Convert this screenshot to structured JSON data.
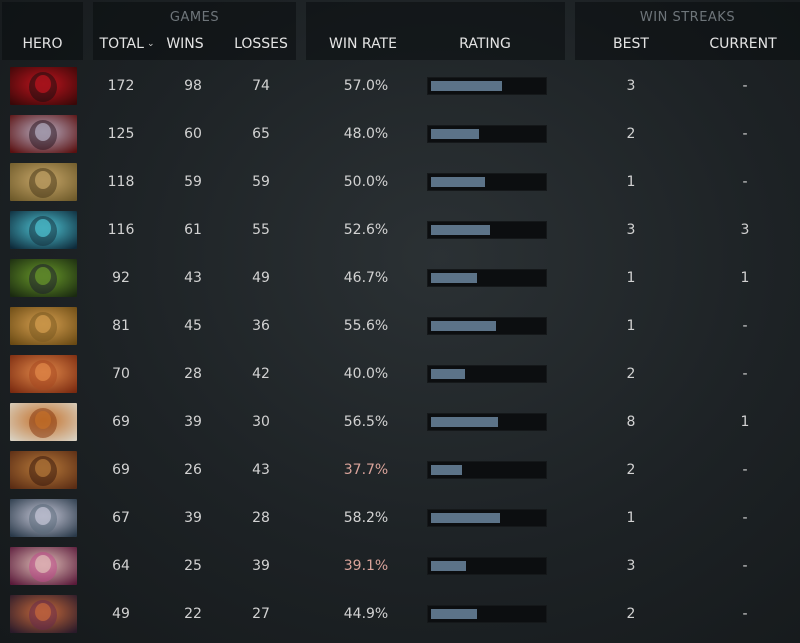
{
  "header": {
    "hero": "HERO",
    "games": "GAMES",
    "total": "TOTAL",
    "wins": "WINS",
    "losses": "LOSSES",
    "win_rate": "WIN RATE",
    "rating": "RATING",
    "win_streaks": "WIN STREAKS",
    "best": "BEST",
    "current": "CURRENT",
    "sort_icon": "chevron-down-icon"
  },
  "colors": {
    "low_win_rate": "#d9a39a",
    "rating_fill": "#5c7388",
    "rating_track": "#0c0e10"
  },
  "rows": [
    {
      "total": "172",
      "wins": "98",
      "losses": "74",
      "win_rate": "57.0%",
      "rating": 0.63,
      "best": "3",
      "current": "-",
      "low": false,
      "portrait": [
        "#3a0808",
        "#c0141e",
        "#1b0e10"
      ]
    },
    {
      "total": "125",
      "wins": "60",
      "losses": "65",
      "win_rate": "48.0%",
      "rating": 0.43,
      "best": "2",
      "current": "-",
      "low": false,
      "portrait": [
        "#5a1010",
        "#b8b0c4",
        "#2b1822"
      ]
    },
    {
      "total": "118",
      "wins": "59",
      "losses": "59",
      "win_rate": "50.0%",
      "rating": 0.48,
      "best": "1",
      "current": "-",
      "low": false,
      "portrait": [
        "#6e5a2a",
        "#c9a86a",
        "#4a3a1c"
      ]
    },
    {
      "total": "116",
      "wins": "61",
      "losses": "55",
      "win_rate": "52.6%",
      "rating": 0.53,
      "best": "3",
      "current": "3",
      "low": false,
      "portrait": [
        "#0e2a3a",
        "#4fc6d6",
        "#15323e"
      ]
    },
    {
      "total": "92",
      "wins": "43",
      "losses": "49",
      "win_rate": "46.7%",
      "rating": 0.41,
      "best": "1",
      "current": "1",
      "low": false,
      "portrait": [
        "#1a2a10",
        "#6a9a2a",
        "#1e1e2e"
      ]
    },
    {
      "total": "81",
      "wins": "45",
      "losses": "36",
      "win_rate": "55.6%",
      "rating": 0.58,
      "best": "1",
      "current": "-",
      "low": false,
      "portrait": [
        "#6a4a14",
        "#d7a050",
        "#7a5a20"
      ]
    },
    {
      "total": "70",
      "wins": "28",
      "losses": "42",
      "win_rate": "40.0%",
      "rating": 0.3,
      "best": "2",
      "current": "-",
      "low": false,
      "portrait": [
        "#7a2a10",
        "#e38a4a",
        "#a84820"
      ]
    },
    {
      "total": "69",
      "wins": "39",
      "losses": "30",
      "win_rate": "56.5%",
      "rating": 0.6,
      "best": "8",
      "current": "1",
      "low": false,
      "portrait": [
        "#d8d0c0",
        "#c4702a",
        "#8a3c12"
      ]
    },
    {
      "total": "69",
      "wins": "26",
      "losses": "43",
      "win_rate": "37.7%",
      "rating": 0.28,
      "best": "2",
      "current": "-",
      "low": true,
      "portrait": [
        "#5a2c14",
        "#b87a3a",
        "#3a1a0c"
      ]
    },
    {
      "total": "67",
      "wins": "39",
      "losses": "28",
      "win_rate": "58.2%",
      "rating": 0.62,
      "best": "1",
      "current": "-",
      "low": false,
      "portrait": [
        "#2a3a4a",
        "#c8c8d8",
        "#5a6a7a"
      ]
    },
    {
      "total": "64",
      "wins": "25",
      "losses": "39",
      "win_rate": "39.1%",
      "rating": 0.31,
      "best": "3",
      "current": "-",
      "low": true,
      "portrait": [
        "#5a1a3a",
        "#e0c0b8",
        "#c04a8a"
      ]
    },
    {
      "total": "49",
      "wins": "22",
      "losses": "27",
      "win_rate": "44.9%",
      "rating": 0.41,
      "best": "2",
      "current": "-",
      "low": false,
      "portrait": [
        "#2a1a2a",
        "#c86a3a",
        "#6a2a4a"
      ]
    }
  ]
}
